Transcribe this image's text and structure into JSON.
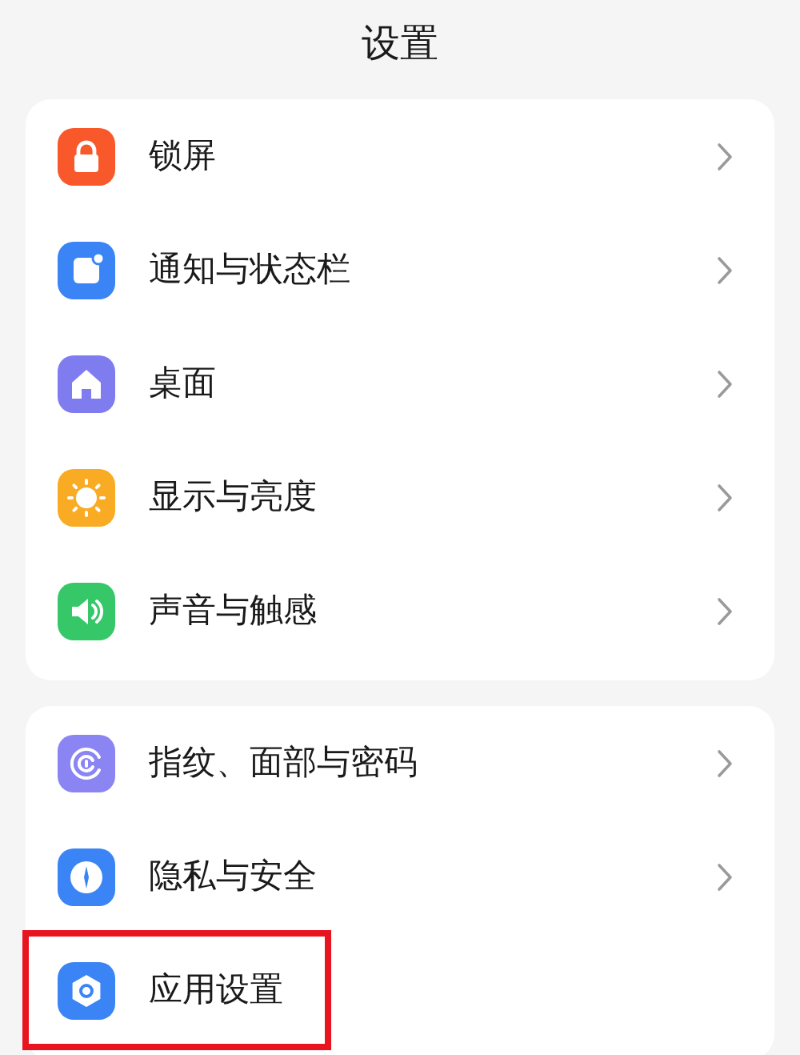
{
  "title": "设置",
  "groups": [
    {
      "items": [
        {
          "label": "锁屏",
          "kind": "lock",
          "color": "#f8582a",
          "highlighted": false
        },
        {
          "label": "通知与状态栏",
          "kind": "notification",
          "color": "#3a84f5",
          "highlighted": false
        },
        {
          "label": "桌面",
          "kind": "home",
          "color": "#7f7cf0",
          "highlighted": false
        },
        {
          "label": "显示与亮度",
          "kind": "sun",
          "color": "#f9ab24",
          "highlighted": false
        },
        {
          "label": "声音与触感",
          "kind": "sound",
          "color": "#35c768",
          "highlighted": false
        }
      ]
    },
    {
      "items": [
        {
          "label": "指纹、面部与密码",
          "kind": "fingerprint",
          "color": "#8a85f2",
          "highlighted": false
        },
        {
          "label": "隐私与安全",
          "kind": "privacy",
          "color": "#3a84f5",
          "highlighted": false
        },
        {
          "label": "应用设置",
          "kind": "apps",
          "color": "#3a84f5",
          "highlighted": true
        }
      ]
    }
  ]
}
